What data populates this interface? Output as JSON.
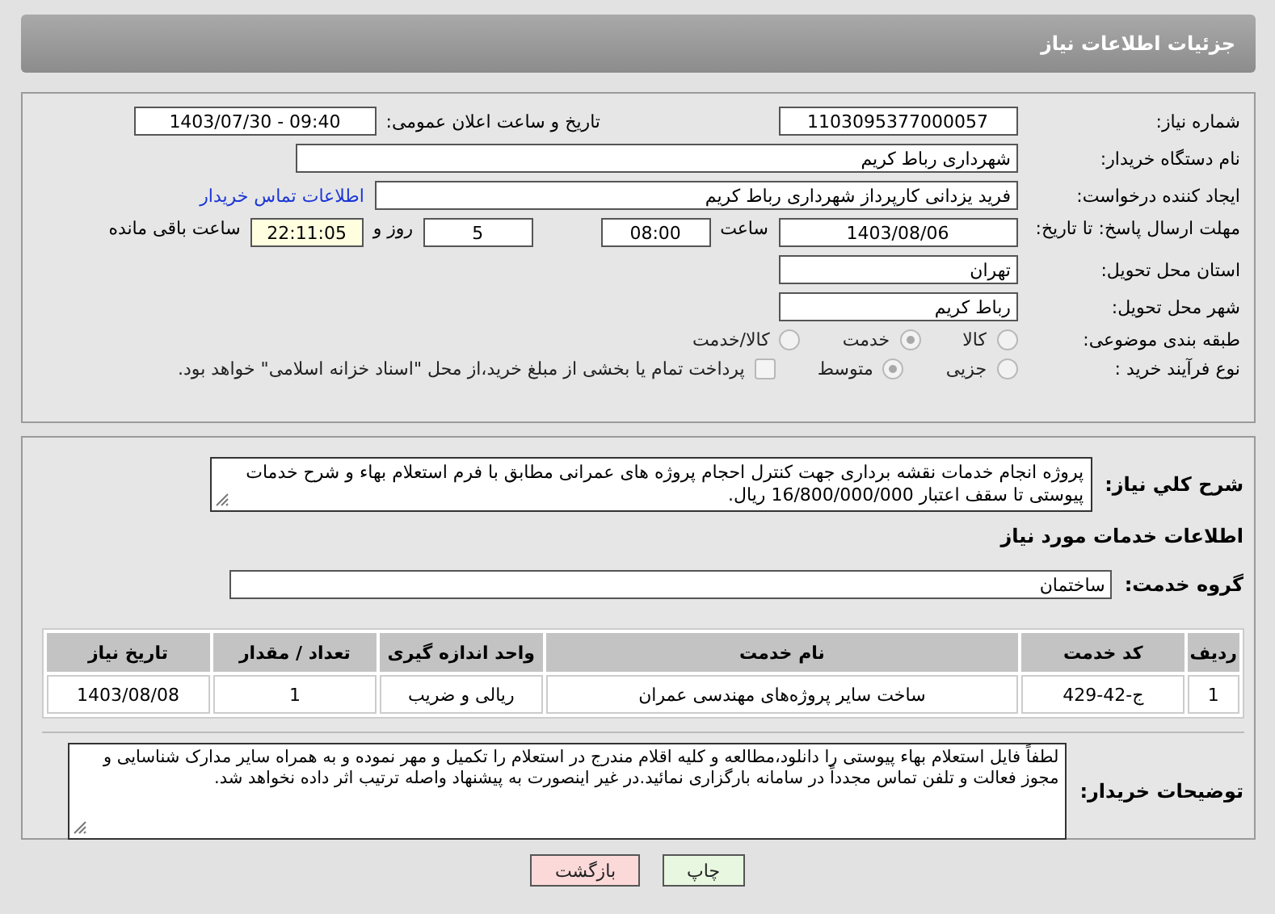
{
  "header": {
    "title": "جزئیات اطلاعات نیاز"
  },
  "summary": {
    "need_number": {
      "label": "شماره نیاز:",
      "value": "1103095377000057"
    },
    "announce": {
      "label": "تاریخ و ساعت اعلان عمومی:",
      "value": "1403/07/30 - 09:40"
    },
    "buyer_org": {
      "label": "نام دستگاه خریدار:",
      "value": "شهرداری رباط کریم"
    },
    "requester": {
      "label": "ایجاد کننده درخواست:",
      "value": "فرید یزدانی کارپرداز شهرداری رباط کریم",
      "link": "اطلاعات تماس خریدار"
    },
    "deadline": {
      "label": "مهلت ارسال پاسخ: تا تاریخ:",
      "date": "1403/08/06",
      "time_label": "ساعت",
      "time": "08:00",
      "days": "5",
      "days_label": "روز و",
      "remaining": "22:11:05",
      "remaining_label": "ساعت باقی مانده"
    },
    "province": {
      "label": "استان محل تحویل:",
      "value": "تهران"
    },
    "city": {
      "label": "شهر محل تحویل:",
      "value": "رباط کریم"
    },
    "category": {
      "label": "طبقه بندی موضوعی:",
      "options": [
        {
          "label": "کالا",
          "selected": false
        },
        {
          "label": "خدمت",
          "selected": true
        },
        {
          "label": "کالا/خدمت",
          "selected": false
        }
      ]
    },
    "process": {
      "label": "نوع فرآیند خرید :",
      "options": [
        {
          "label": "جزیی",
          "selected": false
        },
        {
          "label": "متوسط",
          "selected": true
        }
      ],
      "payment": {
        "label": "پرداخت تمام یا بخشی از مبلغ خرید،از محل \"اسناد خزانه اسلامی\" خواهد بود.",
        "checked": false
      }
    }
  },
  "services": {
    "description": {
      "label": "شرح کلي نياز:",
      "value": "پروژه انجام خدمات نقشه برداری جهت کنترل احجام پروژه های عمرانی مطابق با فرم استعلام بهاء و شرح خدمات پیوستی تا سقف اعتبار 16/800/000/000 ریال."
    },
    "heading": "اطلاعات خدمات مورد نیاز",
    "service_group": {
      "label": "گروه خدمت:",
      "value": "ساختمان"
    },
    "table": {
      "columns": [
        "ردیف",
        "کد خدمت",
        "نام خدمت",
        "واحد اندازه گیری",
        "تعداد / مقدار",
        "تاریخ نیاز"
      ],
      "rows": [
        [
          "1",
          "ج-42-429",
          "ساخت سایر پروژه‌های مهندسی عمران",
          "ریالی و ضریب",
          "1",
          "1403/08/08"
        ]
      ]
    },
    "buyer_notes": {
      "label": "توضیحات خریدار:",
      "value": "لطفاً فایل استعلام بهاء پیوستی را دانلود،مطالعه و کلیه اقلام مندرج در استعلام را تکمیل و مهر نموده و به همراه سایر مدارک شناسایی و مجوز فعالت و تلفن تماس مجدداً در سامانه بارگزاری نمائید.در غیر اینصورت به پیشنهاد واصله ترتیب اثر داده نخواهد شد."
    }
  },
  "buttons": [
    {
      "label": "چاپ",
      "kind": "print"
    },
    {
      "label": "بازگشت",
      "kind": "back"
    }
  ]
}
